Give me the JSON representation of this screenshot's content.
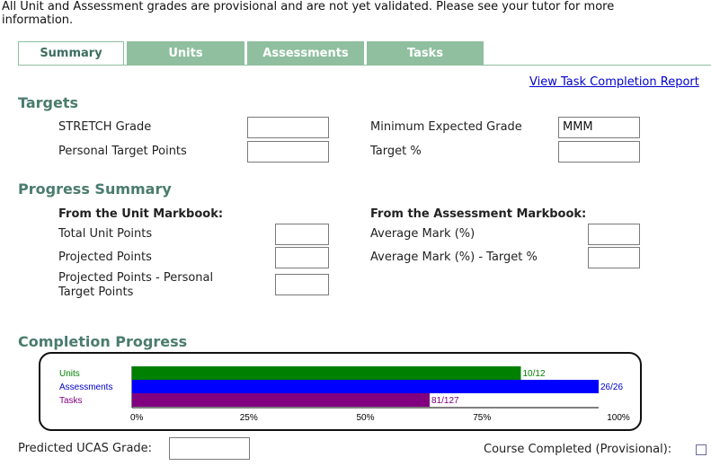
{
  "notice": "All Unit and Assessment grades are provisional and are not yet validated. Please see your tutor for more information.",
  "tabs": [
    {
      "label": "Summary"
    },
    {
      "label": "Units"
    },
    {
      "label": "Assessments"
    },
    {
      "label": "Tasks"
    }
  ],
  "view_report_link": "View Task Completion Report",
  "targets": {
    "title": "Targets",
    "stretch_grade_label": "STRETCH Grade",
    "stretch_grade_value": "",
    "personal_target_points_label": "Personal Target Points",
    "personal_target_points_value": "",
    "min_expected_grade_label": "Minimum Expected Grade",
    "min_expected_grade_value": "MMM",
    "target_pct_label": "Target %",
    "target_pct_value": ""
  },
  "progress": {
    "title": "Progress Summary",
    "unit_heading": "From the Unit Markbook:",
    "assessment_heading": "From the Assessment Markbook:",
    "total_unit_points_label": "Total Unit Points",
    "total_unit_points_value": "",
    "projected_points_label": "Projected Points",
    "projected_points_value": "",
    "projected_minus_target_label": "Projected Points - Personal Target Points",
    "projected_minus_target_value": "",
    "average_mark_label": "Average Mark (%)",
    "average_mark_value": "",
    "average_mark_minus_target_label": "Average Mark (%) - Target %",
    "average_mark_minus_target_value": ""
  },
  "completion": {
    "title": "Completion Progress"
  },
  "footer": {
    "predicted_ucas_label": "Predicted UCAS Grade:",
    "predicted_ucas_value": "",
    "course_completed_label": "Course Completed (Provisional):"
  },
  "chart_data": {
    "type": "bar",
    "orientation": "horizontal",
    "categories": [
      "Units",
      "Assessments",
      "Tasks"
    ],
    "completed": [
      10,
      26,
      81
    ],
    "totals": [
      12,
      26,
      127
    ],
    "value_labels": [
      "10/12",
      "26/26",
      "81/127"
    ],
    "colors": [
      "#008000",
      "#0000ff",
      "#800080"
    ],
    "label_colors": [
      "#008000",
      "#0000cc",
      "#800080"
    ],
    "x_ticks": [
      "0%",
      "25%",
      "50%",
      "75%",
      "100%"
    ],
    "xlim": [
      0,
      100
    ]
  }
}
